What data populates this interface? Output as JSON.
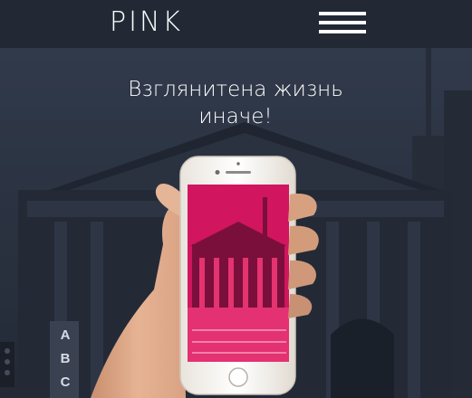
{
  "header": {
    "logo": "PINK",
    "menu_icon": "hamburger-menu-icon"
  },
  "hero": {
    "headline_line1": "Взглянитена жизнь",
    "headline_line2": "иначе!",
    "background_image": "city-library-building",
    "device_image": "hand-holding-smartphone",
    "signage_letters": [
      "A",
      "B",
      "C"
    ],
    "colors": {
      "overlay": "#2b3342",
      "header": "#222935",
      "screen_pink": "#d1155f"
    }
  }
}
